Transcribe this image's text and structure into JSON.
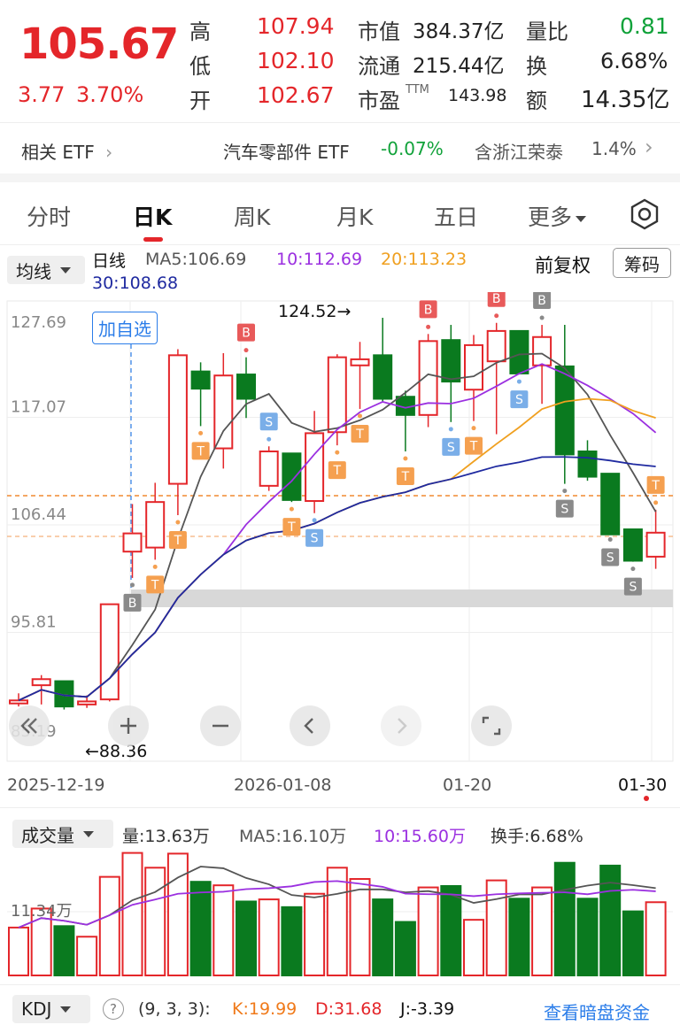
{
  "quote": {
    "price": "105.67",
    "change": "3.77",
    "change_pct": "3.70%",
    "high_label": "高",
    "high": "107.94",
    "low_label": "低",
    "low": "102.10",
    "open_label": "开",
    "open": "102.67",
    "mktcap_label": "市值",
    "mktcap": "384.37亿",
    "float_label": "流通",
    "float": "215.44亿",
    "pe_label": "市盈",
    "pe_sup": "TTM",
    "pe": "143.98",
    "volratio_label": "量比",
    "volratio": "0.81",
    "turnover_label": "换",
    "turnover": "6.68%",
    "amount_label": "额",
    "amount": "14.35亿"
  },
  "etf": {
    "label": "相关 ETF",
    "name": "汽车零部件 ETF",
    "change": "-0.07%",
    "holding": "含浙江荣泰",
    "holding_pct": "1.4%"
  },
  "tabs": [
    "分时",
    "日K",
    "周K",
    "月K",
    "五日",
    "更多"
  ],
  "active_tab": "日K",
  "chart_header": {
    "ma_dropdown": "均线",
    "line_label": "日线",
    "ma5": "MA5:106.69",
    "ma10": "10:112.69",
    "ma20": "20:113.23",
    "ma30": "30:108.68",
    "adjust": "前复权",
    "chips": "筹码"
  },
  "colors": {
    "up": "#e4262a",
    "down": "#0a7a1f",
    "ma5": "#555555",
    "ma10": "#9b30e0",
    "ma20": "#f0a020",
    "ma30": "#1f2aa0",
    "orange": "#f5a050"
  },
  "axis": {
    "y_labels": [
      "127.69",
      "117.07",
      "106.44",
      "95.81",
      "85.19"
    ],
    "x_labels": [
      "2025-12-19",
      "2026-01-08",
      "01-20",
      "01-30"
    ],
    "max_label": "124.52→",
    "min_label": "←88.36",
    "add_watch": "加自选"
  },
  "volume": {
    "dropdown": "成交量",
    "vol": "量:13.63万",
    "ma5": "MA5:16.10万",
    "ma10": "10:15.60万",
    "turnover": "换手:6.68%",
    "y_label": "11.34万"
  },
  "kdj": {
    "dropdown": "KDJ",
    "help": "?",
    "params": "(9, 3, 3):",
    "k": "K:19.99",
    "d": "D:31.68",
    "j": "J:-3.39",
    "link": "查看暗盘资金"
  },
  "markers": {
    "b": "B",
    "s": "S",
    "t": "T"
  },
  "chart_data": {
    "type": "candlestick",
    "candles": [
      {
        "o": 88.8,
        "h": 89.8,
        "l": 88.5,
        "c": 89.1
      },
      {
        "o": 90.6,
        "h": 91.6,
        "l": 88.7,
        "c": 91.2
      },
      {
        "o": 91.0,
        "h": 91.0,
        "l": 88.2,
        "c": 88.5
      },
      {
        "o": 88.7,
        "h": 89.6,
        "l": 88.36,
        "c": 89.0
      },
      {
        "o": 89.2,
        "h": 98.6,
        "l": 89.0,
        "c": 98.6
      },
      {
        "o": 103.8,
        "h": 108.5,
        "l": 101.2,
        "c": 105.6
      },
      {
        "o": 104.2,
        "h": 110.6,
        "l": 103.0,
        "c": 108.7
      },
      {
        "o": 110.5,
        "h": 123.8,
        "l": 107.4,
        "c": 123.2
      },
      {
        "o": 121.6,
        "h": 122.5,
        "l": 116.2,
        "c": 119.9
      },
      {
        "o": 114.0,
        "h": 123.4,
        "l": 112.0,
        "c": 121.2
      },
      {
        "o": 121.3,
        "h": 123.0,
        "l": 117.0,
        "c": 118.9
      },
      {
        "o": 110.3,
        "h": 114.2,
        "l": 109.8,
        "c": 113.7
      },
      {
        "o": 113.5,
        "h": 113.5,
        "l": 108.7,
        "c": 108.9
      },
      {
        "o": 108.8,
        "h": 117.7,
        "l": 107.6,
        "c": 115.5
      },
      {
        "o": 115.6,
        "h": 123.3,
        "l": 114.3,
        "c": 123.0
      },
      {
        "o": 122.2,
        "h": 124.52,
        "l": 117.9,
        "c": 122.8
      },
      {
        "o": 123.2,
        "h": 126.9,
        "l": 118.6,
        "c": 118.9
      },
      {
        "o": 119.1,
        "h": 119.7,
        "l": 113.7,
        "c": 117.3
      },
      {
        "o": 117.3,
        "h": 125.3,
        "l": 116.1,
        "c": 124.6
      },
      {
        "o": 124.7,
        "h": 126.2,
        "l": 116.6,
        "c": 120.6
      },
      {
        "o": 119.8,
        "h": 125.2,
        "l": 116.7,
        "c": 124.2
      },
      {
        "o": 122.6,
        "h": 126.4,
        "l": 115.4,
        "c": 125.6
      },
      {
        "o": 125.6,
        "h": 125.6,
        "l": 121.3,
        "c": 121.4
      },
      {
        "o": 122.2,
        "h": 126.2,
        "l": 118.4,
        "c": 125.0
      },
      {
        "o": 122.1,
        "h": 126.2,
        "l": 110.5,
        "c": 113.4
      },
      {
        "o": 113.7,
        "h": 114.8,
        "l": 110.8,
        "c": 111.2
      },
      {
        "o": 111.5,
        "h": 111.5,
        "l": 105.7,
        "c": 105.5
      },
      {
        "o": 106.0,
        "h": 106.0,
        "l": 102.8,
        "c": 102.9
      },
      {
        "o": 103.3,
        "h": 107.94,
        "l": 102.1,
        "c": 105.67
      }
    ],
    "volume": [
      6.8,
      9.5,
      7.0,
      5.5,
      14.0,
      17.4,
      15.3,
      17.3,
      13.3,
      12.8,
      10.5,
      10.8,
      9.7,
      11.6,
      15.3,
      13.7,
      10.8,
      7.6,
      12.5,
      12.7,
      7.9,
      13.5,
      10.9,
      12.5,
      16.0,
      10.9,
      15.6,
      9.1,
      10.4
    ],
    "ylim": [
      85.19,
      127.69
    ],
    "vol_max": 17.6
  }
}
